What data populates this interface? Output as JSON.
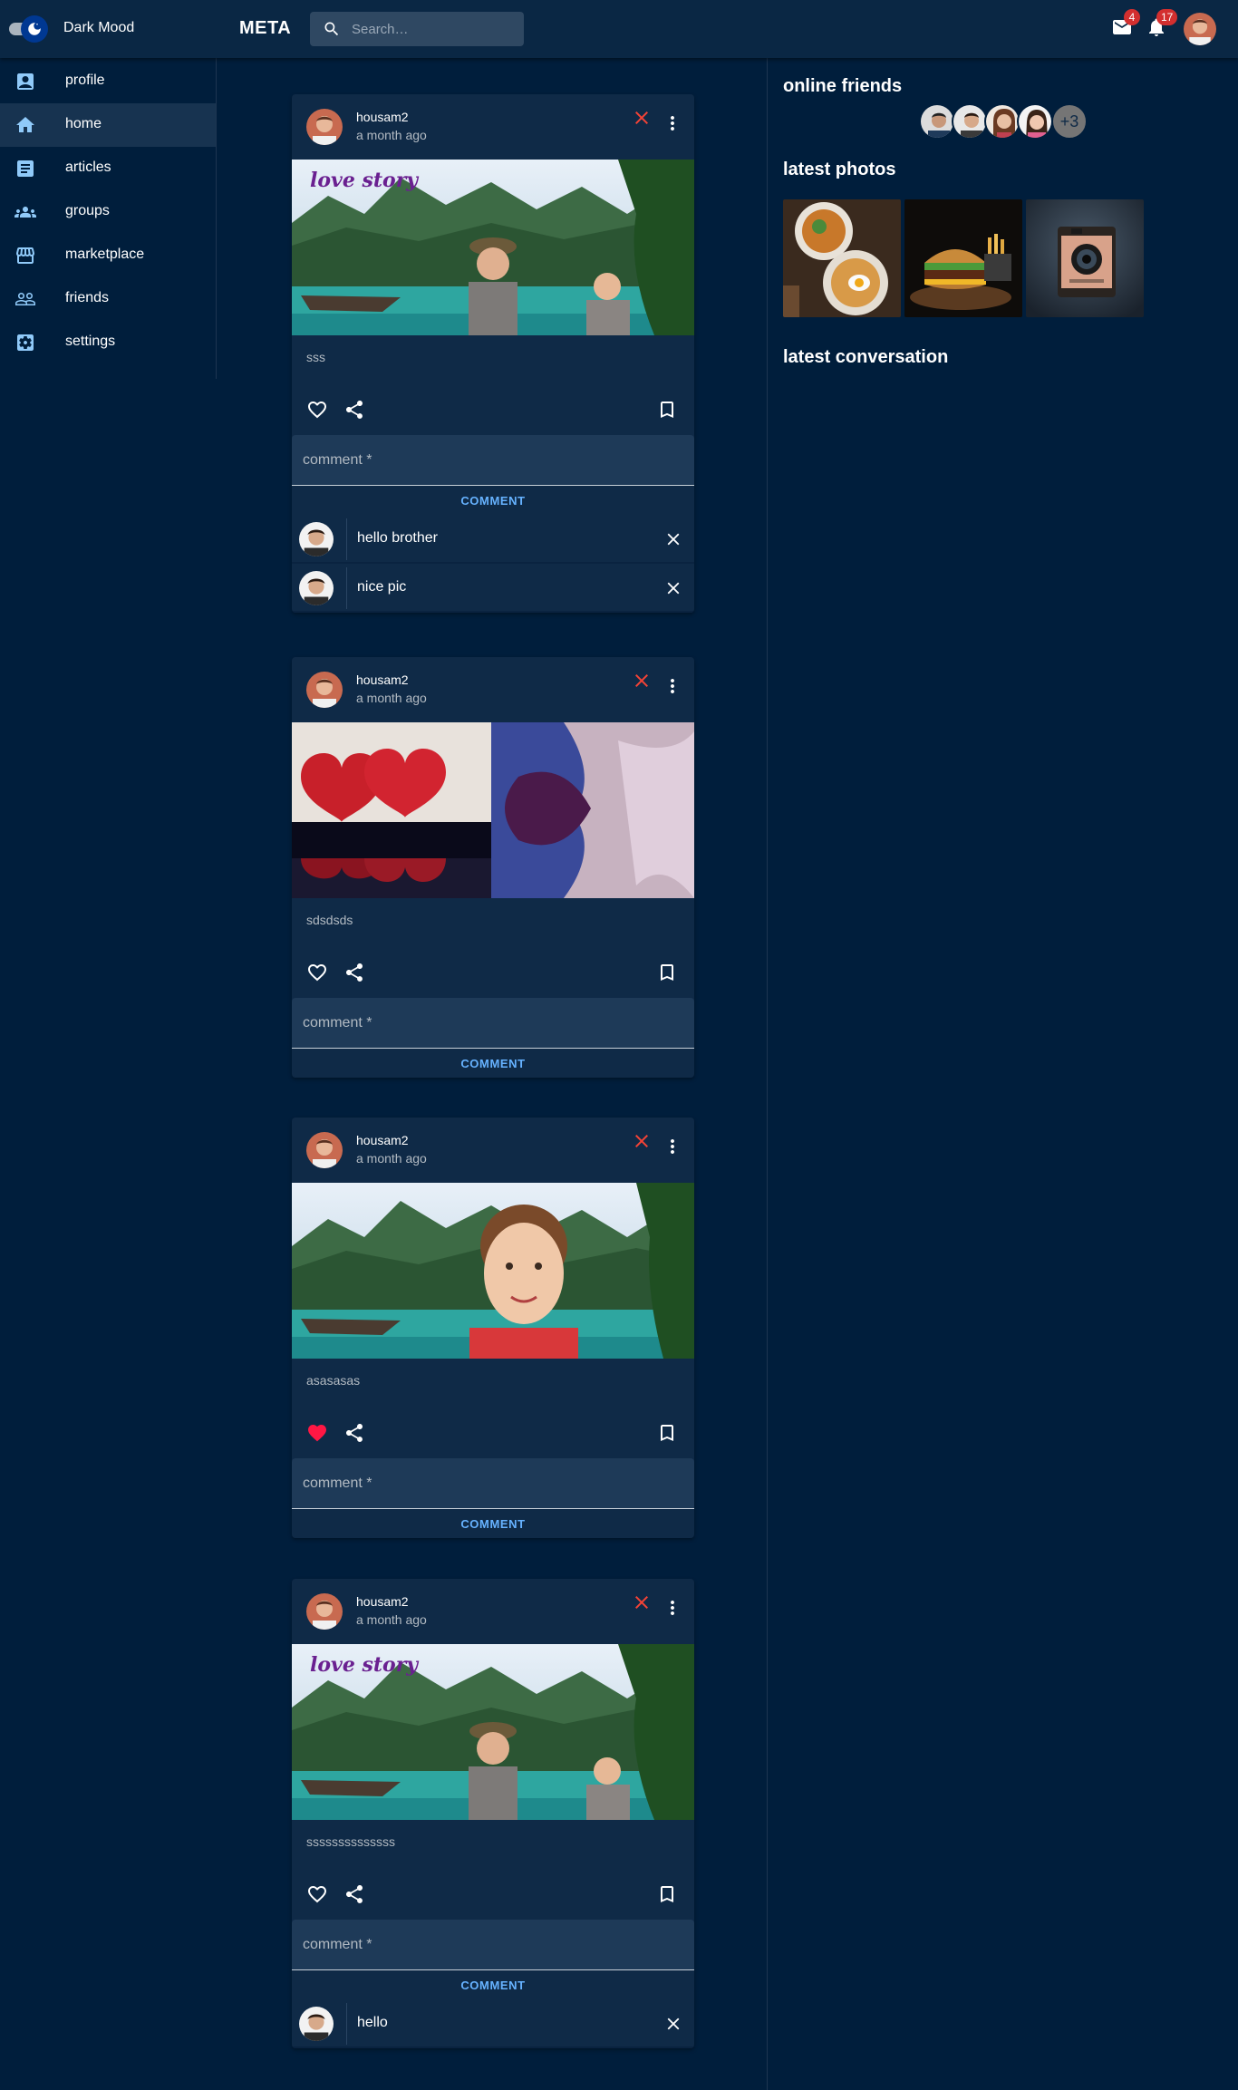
{
  "header": {
    "mode_label": "Dark Mood",
    "brand": "META",
    "search_placeholder": "Search…",
    "mail_badge": "4",
    "notification_badge": "17"
  },
  "sidebar": {
    "items": [
      {
        "label": "profile",
        "icon": "profile-icon"
      },
      {
        "label": "home",
        "icon": "home-icon",
        "active": true
      },
      {
        "label": "articles",
        "icon": "article-icon"
      },
      {
        "label": "groups",
        "icon": "groups-icon"
      },
      {
        "label": "marketplace",
        "icon": "store-icon"
      },
      {
        "label": "friends",
        "icon": "friends-icon"
      },
      {
        "label": "settings",
        "icon": "settings-icon"
      }
    ]
  },
  "posts": [
    {
      "author": "housam2",
      "time": "a month ago",
      "text": "sss",
      "liked": false,
      "comment_placeholder": "comment *",
      "comment_button": "COMMENT",
      "comments": [
        {
          "text": "hello brother"
        },
        {
          "text": "nice pic"
        }
      ]
    },
    {
      "author": "housam2",
      "time": "a month ago",
      "text": "sdsdsds",
      "liked": false,
      "comment_placeholder": "comment *",
      "comment_button": "COMMENT",
      "comments": []
    },
    {
      "author": "housam2",
      "time": "a month ago",
      "text": "asasasas",
      "liked": true,
      "comment_placeholder": "comment *",
      "comment_button": "COMMENT",
      "comments": []
    },
    {
      "author": "housam2",
      "time": "a month ago",
      "text": "ssssssssssssss",
      "liked": false,
      "comment_placeholder": "comment *",
      "comment_button": "COMMENT",
      "comments": [
        {
          "text": "hello"
        }
      ]
    }
  ],
  "right_panel": {
    "online_friends_title": "online friends",
    "friends_more": "+3",
    "latest_photos_title": "latest photos",
    "latest_conversation_title": "latest conversation"
  },
  "colors": {
    "background": "#001e3c",
    "card": "#0f2a47",
    "accent": "#66b2ff",
    "delete_red": "#f44336",
    "like_red": "#ff1744"
  }
}
